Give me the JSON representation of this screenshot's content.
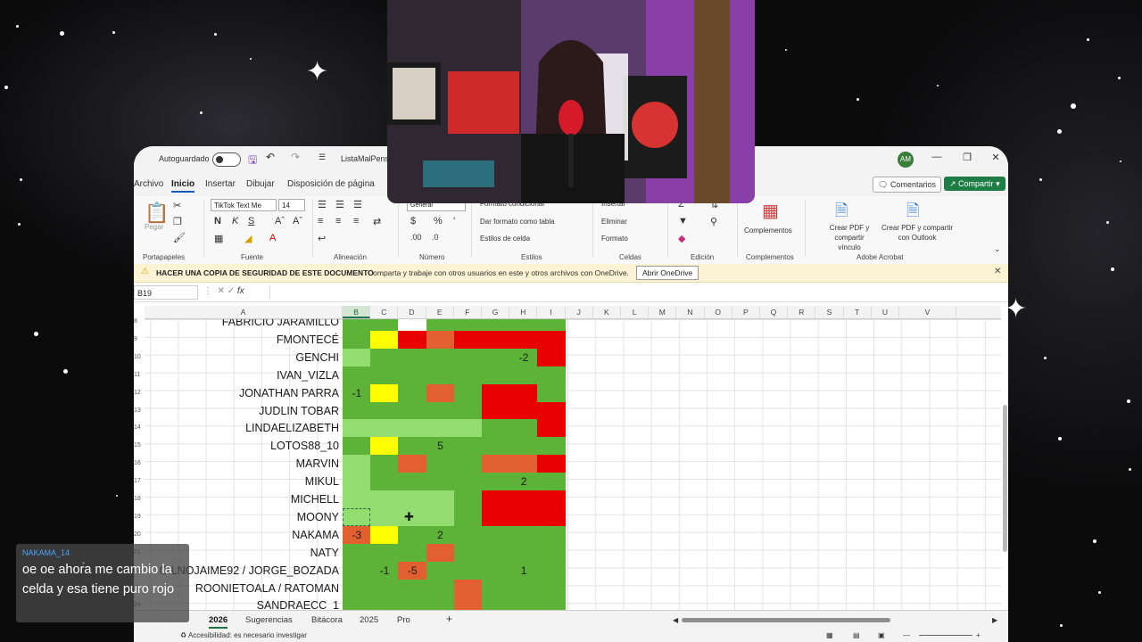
{
  "titlebar": {
    "autosave_label": "Autoguardado",
    "doc_title": "ListaMalPens",
    "avatar_initials": "AM"
  },
  "ribbon_tabs": [
    "Archivo",
    "Inicio",
    "Insertar",
    "Dibujar",
    "Disposición de página"
  ],
  "buttons": {
    "comments": "Comentarios",
    "share": "Compartir"
  },
  "ribbon": {
    "paste": "Pegar",
    "font_name": "TikTok Text Me",
    "font_size": "14",
    "number_format": "General",
    "cond_format": "Formato condicional",
    "table_format": "Dar formato como tabla",
    "cell_styles": "Estilos de celda",
    "insert": "Insertar",
    "delete": "Eliminar",
    "format": "Formato",
    "addins": "Complementos",
    "pdf_link": "Crear PDF y compartir vínculo",
    "pdf_outlook": "Crear PDF y compartir con Outlook",
    "groups": [
      "Portapapeles",
      "Fuente",
      "Alineación",
      "Número",
      "Estilos",
      "Celdas",
      "Edición",
      "Complementos",
      "Adobe Acrobat"
    ]
  },
  "notice": {
    "title": "HACER UNA COPIA DE SEGURIDAD DE ESTE DOCUMENTO",
    "text": "Comparta y trabaje con otros usuarios en este y otros archivos con OneDrive.",
    "button": "Abrir OneDrive"
  },
  "formula_bar": {
    "name_box": "B19"
  },
  "columns": [
    "A",
    "B",
    "C",
    "D",
    "E",
    "F",
    "G",
    "H",
    "I",
    "J",
    "K",
    "L",
    "M",
    "N",
    "O",
    "P",
    "Q",
    "R",
    "S",
    "T",
    "U",
    "V"
  ],
  "colors": {
    "green": "#5cb338",
    "light_green": "#93dc6f",
    "yellow": "#ffff00",
    "orange": "#e2602f",
    "red": "#e80000",
    "excel_green": "#217346"
  },
  "rows": [
    {
      "num": "8",
      "name": "FABRICIO JARAMILLO",
      "cells": [
        "green",
        "green",
        "white",
        "green",
        "green",
        "green",
        "green",
        "green"
      ],
      "values": [
        "",
        "",
        "",
        "",
        "",
        "",
        "",
        ""
      ]
    },
    {
      "num": "9",
      "name": "FMONTECÉ",
      "cells": [
        "green",
        "yellow",
        "red",
        "orange",
        "red",
        "red",
        "red",
        "red"
      ],
      "values": [
        "",
        "",
        "",
        "",
        "",
        "",
        "",
        ""
      ]
    },
    {
      "num": "10",
      "name": "GENCHI",
      "cells": [
        "light_green",
        "green",
        "green",
        "green",
        "green",
        "green",
        "green",
        "red"
      ],
      "values": [
        "",
        "",
        "",
        "",
        "",
        "",
        "-2",
        ""
      ]
    },
    {
      "num": "11",
      "name": "IVAN_VIZLA",
      "cells": [
        "green",
        "green",
        "green",
        "green",
        "green",
        "green",
        "green",
        "green"
      ],
      "values": [
        "",
        "",
        "",
        "",
        "",
        "",
        "",
        ""
      ]
    },
    {
      "num": "12",
      "name": "JONATHAN PARRA",
      "cells": [
        "green",
        "yellow",
        "green",
        "orange",
        "green",
        "red",
        "red",
        "green"
      ],
      "values": [
        "-1",
        "",
        "",
        "",
        "",
        "",
        "",
        ""
      ]
    },
    {
      "num": "13",
      "name": "JUDLIN TOBAR",
      "cells": [
        "green",
        "green",
        "green",
        "green",
        "green",
        "red",
        "red",
        "red"
      ],
      "values": [
        "",
        "",
        "",
        "",
        "",
        "",
        "",
        ""
      ]
    },
    {
      "num": "14",
      "name": "LINDAELIZABETH",
      "cells": [
        "light_green",
        "light_green",
        "light_green",
        "light_green",
        "light_green",
        "green",
        "green",
        "red"
      ],
      "values": [
        "",
        "",
        "",
        "",
        "",
        "",
        "",
        ""
      ]
    },
    {
      "num": "15",
      "name": "LOTOS88_10",
      "cells": [
        "green",
        "yellow",
        "green",
        "green",
        "green",
        "green",
        "green",
        "green"
      ],
      "values": [
        "",
        "",
        "",
        "5",
        "",
        "",
        "",
        ""
      ]
    },
    {
      "num": "16",
      "name": "MARVIN",
      "cells": [
        "light_green",
        "green",
        "orange",
        "green",
        "green",
        "orange",
        "orange",
        "red"
      ],
      "values": [
        "",
        "",
        "",
        "",
        "",
        "",
        "",
        ""
      ]
    },
    {
      "num": "17",
      "name": "MIKUL",
      "cells": [
        "light_green",
        "green",
        "green",
        "green",
        "green",
        "green",
        "green",
        "green"
      ],
      "values": [
        "",
        "",
        "",
        "",
        "",
        "",
        "2",
        ""
      ]
    },
    {
      "num": "18",
      "name": "MICHELL",
      "cells": [
        "light_green",
        "light_green",
        "light_green",
        "light_green",
        "green",
        "red",
        "red",
        "red"
      ],
      "values": [
        "",
        "",
        "",
        "",
        "",
        "",
        "",
        ""
      ]
    },
    {
      "num": "19",
      "name": "MOONY",
      "cells": [
        "light_green",
        "light_green",
        "light_green",
        "light_green",
        "green",
        "red",
        "red",
        "red"
      ],
      "values": [
        "",
        "",
        "",
        "",
        "",
        "",
        "",
        ""
      ]
    },
    {
      "num": "20",
      "name": "NAKAMA",
      "cells": [
        "orange",
        "yellow",
        "green",
        "green",
        "green",
        "green",
        "green",
        "green"
      ],
      "values": [
        "-3",
        "",
        "",
        "2",
        "",
        "",
        "",
        ""
      ]
    },
    {
      "num": "21",
      "name": "NATY",
      "cells": [
        "green",
        "green",
        "green",
        "orange",
        "green",
        "green",
        "green",
        "green"
      ],
      "values": [
        "",
        "",
        "",
        "",
        "",
        "",
        "",
        ""
      ]
    },
    {
      "num": "22",
      "name": "GILNOJAIME92 / JORGE_BOZADA",
      "cells": [
        "green",
        "green",
        "orange",
        "green",
        "green",
        "green",
        "green",
        "green"
      ],
      "values": [
        "",
        "-1",
        "-5",
        "",
        "",
        "",
        "1",
        ""
      ]
    },
    {
      "num": "23",
      "name": "ROONIETOALA / RATOMAN",
      "cells": [
        "green",
        "green",
        "green",
        "green",
        "orange",
        "green",
        "green",
        "green"
      ],
      "values": [
        "",
        "",
        "",
        "",
        "",
        "",
        "",
        ""
      ]
    },
    {
      "num": "24",
      "name": "SANDRAECC_1",
      "cells": [
        "green",
        "green",
        "green",
        "green",
        "orange",
        "green",
        "green",
        "green"
      ],
      "values": [
        "",
        "",
        "",
        "",
        "",
        "",
        "",
        ""
      ]
    }
  ],
  "sheet_tabs": [
    "2026",
    "Sugerencias",
    "Bitácora",
    "2025",
    "Pro"
  ],
  "status": {
    "accessibility": "Accesibilidad: es necesario investigar"
  },
  "chat": {
    "username": "NAKAMA_14",
    "message": "oe oe ahora me cambio la celda y esa tiene puro rojo"
  }
}
